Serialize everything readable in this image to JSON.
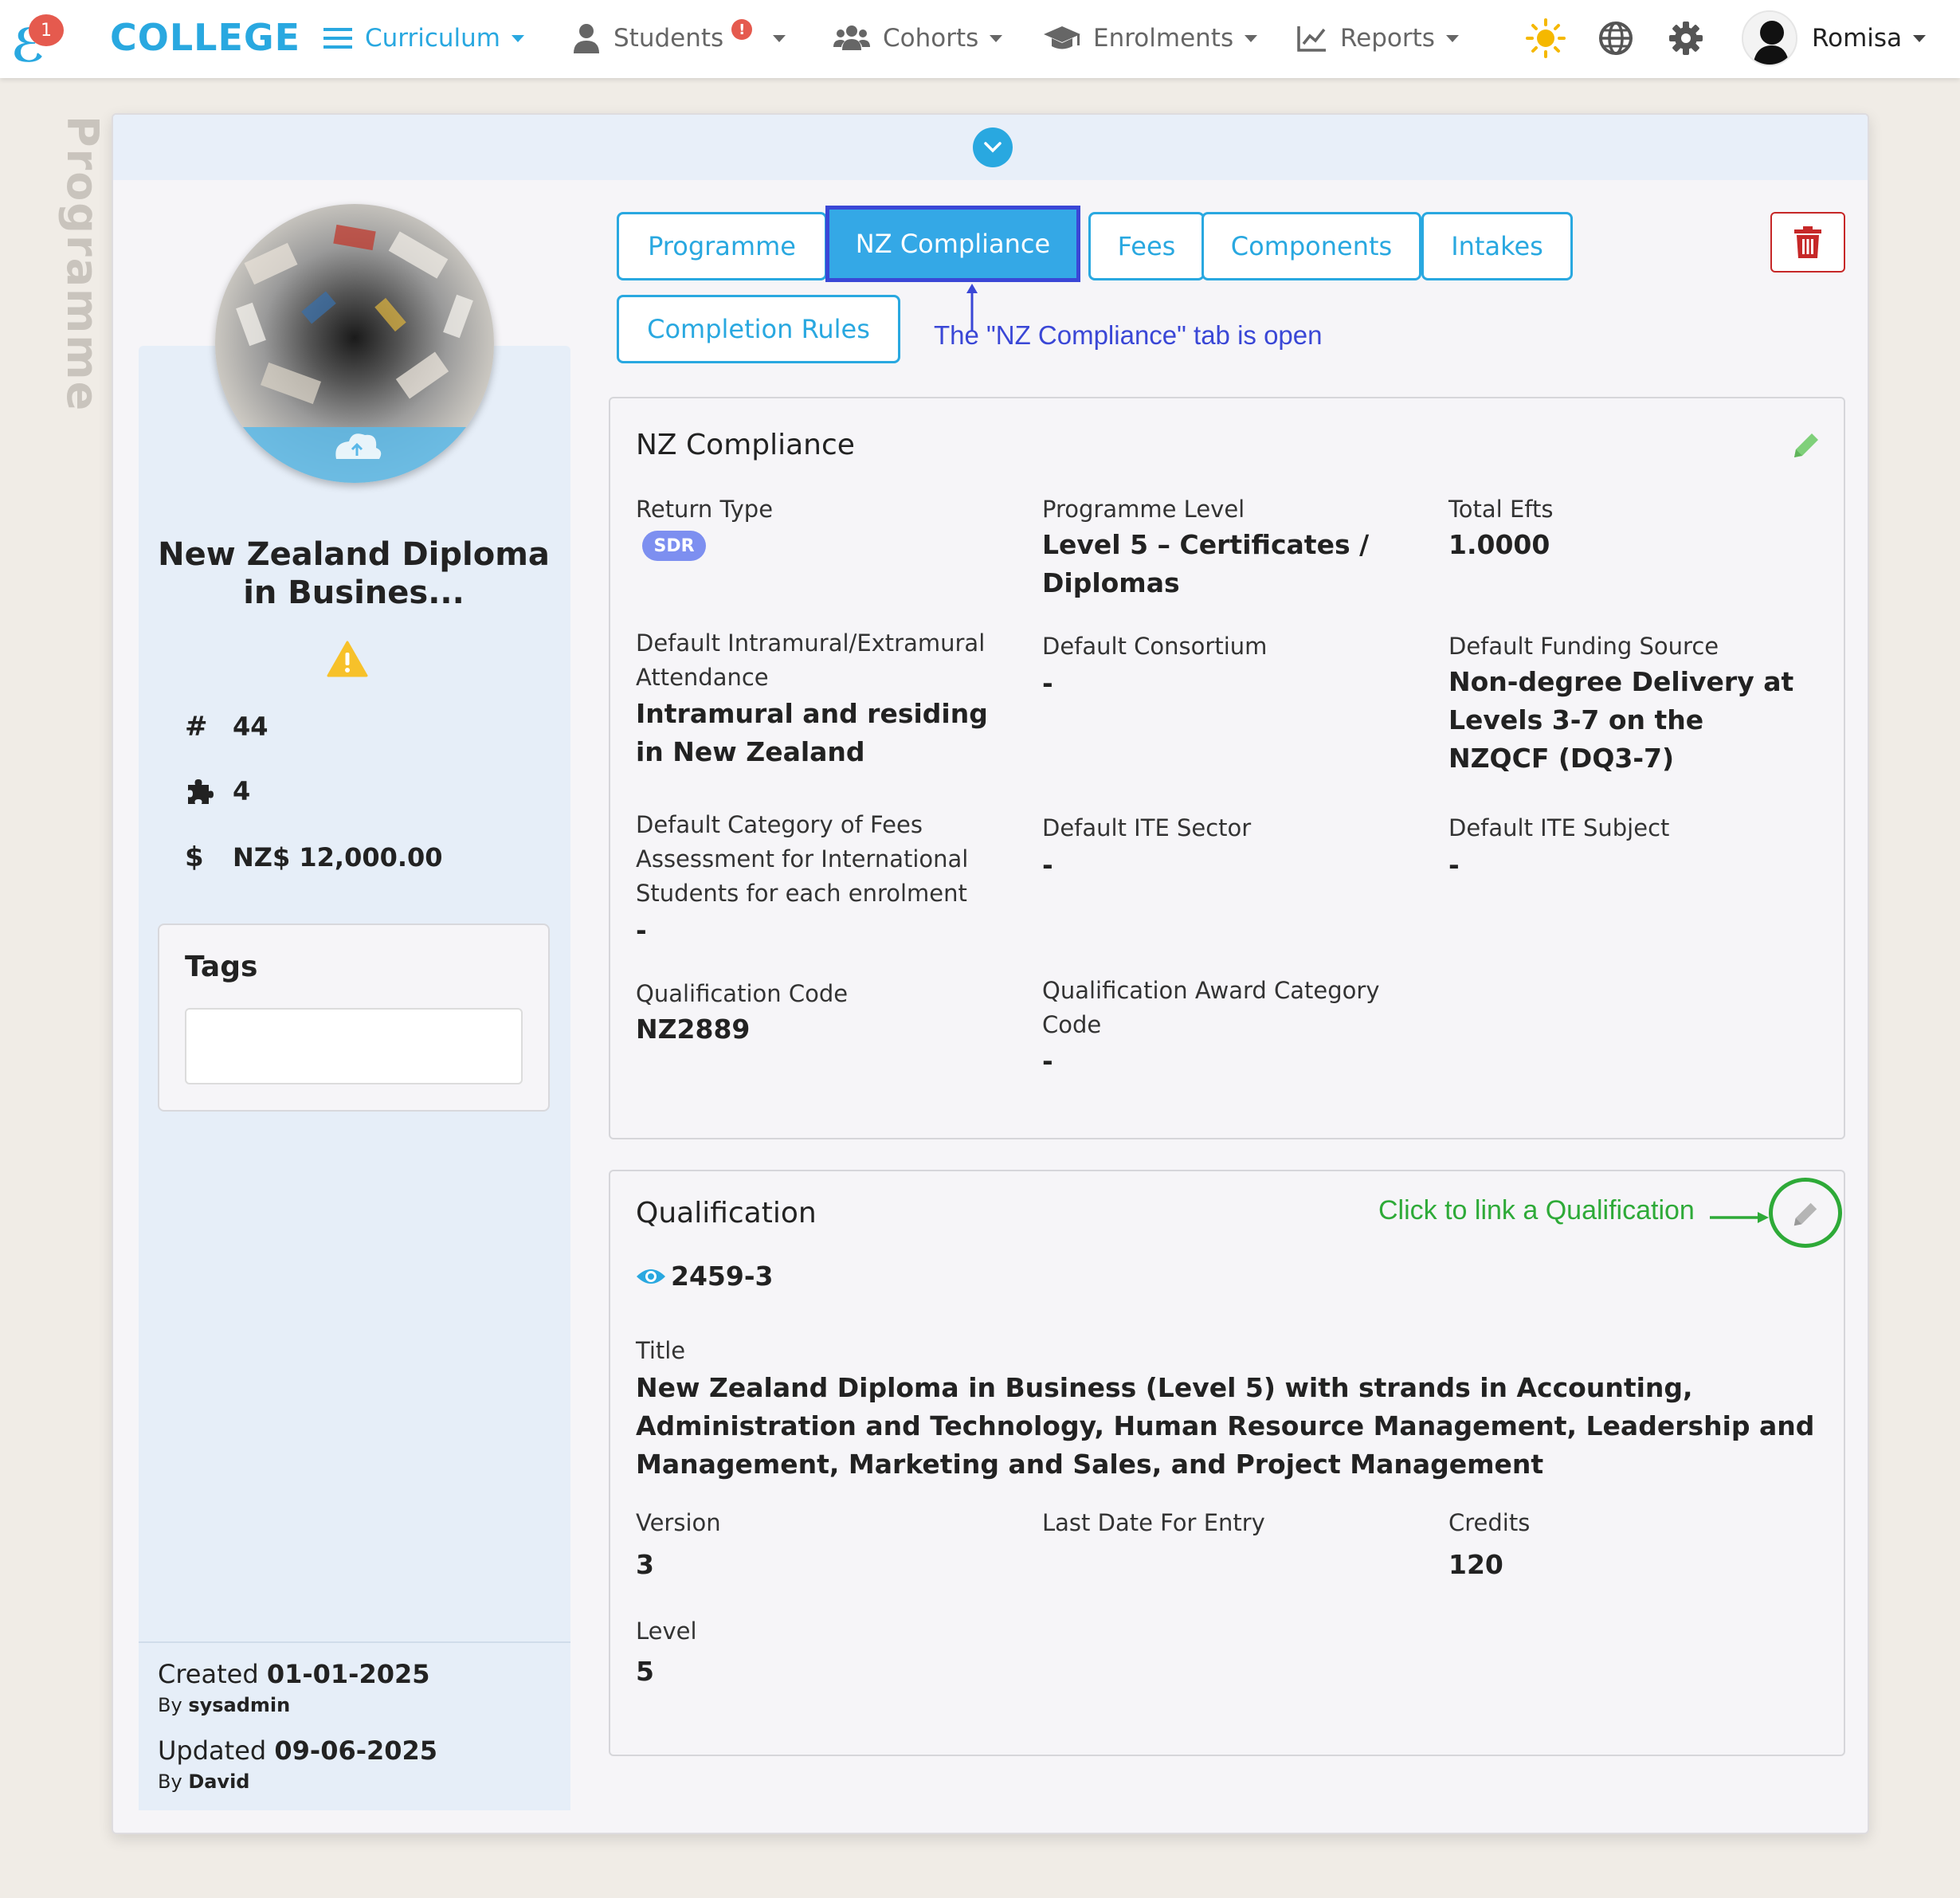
{
  "nav": {
    "brand": "COLLEGE",
    "logo_badge": "1",
    "items": [
      {
        "label": "Curriculum",
        "icon": "menu-lines-icon",
        "active": true
      },
      {
        "label": "Students",
        "icon": "user-icon",
        "alert": "!"
      },
      {
        "label": "Cohorts",
        "icon": "users-icon"
      },
      {
        "label": "Enrolments",
        "icon": "graduation-cap-icon"
      },
      {
        "label": "Reports",
        "icon": "chart-line-icon"
      }
    ],
    "user_name": "Romisa"
  },
  "side_label": "Programme",
  "programme": {
    "title": "New Zealand Diploma in Busines...",
    "id": "44",
    "components": "4",
    "fee": "NZ$ 12,000.00",
    "tags_title": "Tags",
    "created_label": "Created",
    "created_date": "01-01-2025",
    "created_by_label": "By",
    "created_by": "sysadmin",
    "updated_label": "Updated",
    "updated_date": "09-06-2025",
    "updated_by_label": "By",
    "updated_by": "David"
  },
  "tabs": [
    {
      "label": "Programme"
    },
    {
      "label": "NZ Compliance",
      "active": true
    },
    {
      "label": "Fees"
    },
    {
      "label": "Components"
    },
    {
      "label": "Intakes"
    },
    {
      "label": "Completion Rules"
    }
  ],
  "annotations": {
    "tab_open": "The \"NZ Compliance\" tab is open",
    "link_qualification": "Click to link a Qualification"
  },
  "compliance": {
    "title": "NZ Compliance",
    "return_type_label": "Return Type",
    "return_type": "SDR",
    "programme_level_label": "Programme Level",
    "programme_level": "Level 5 – Certificates / Diplomas",
    "total_efts_label": "Total Efts",
    "total_efts": "1.0000",
    "attendance_label": "Default Intramural/Extramural Attendance",
    "attendance": "Intramural and residing in New Zealand",
    "consortium_label": "Default Consortium",
    "consortium": "-",
    "funding_label": "Default Funding Source",
    "funding": "Non-degree Delivery at Levels 3-7 on the NZQCF (DQ3-7)",
    "fees_category_label": "Default Category of Fees Assessment for International Students for each enrolment",
    "fees_category": "-",
    "ite_sector_label": "Default ITE Sector",
    "ite_sector": "-",
    "ite_subject_label": "Default ITE Subject",
    "ite_subject": "-",
    "qual_code_label": "Qualification Code",
    "qual_code": "NZ2889",
    "award_label": "Qualification Award Category Code",
    "award": "-"
  },
  "qualification": {
    "title": "Qualification",
    "code": "2459-3",
    "title_label": "Title",
    "full_title": "New Zealand Diploma in Business (Level 5) with strands in Accounting, Administration and Technology, Human Resource Management, Leadership and Management, Marketing and Sales, and Project Management",
    "version_label": "Version",
    "version": "3",
    "last_entry_label": "Last Date For Entry",
    "last_entry": "",
    "credits_label": "Credits",
    "credits": "120",
    "level_label": "Level",
    "level": "5"
  },
  "colors": {
    "primary": "#29a8e0",
    "active_tab_border": "#3a47d6",
    "annotation_green": "#2eaa38",
    "danger": "#c62828",
    "badge": "#e55a4e"
  }
}
